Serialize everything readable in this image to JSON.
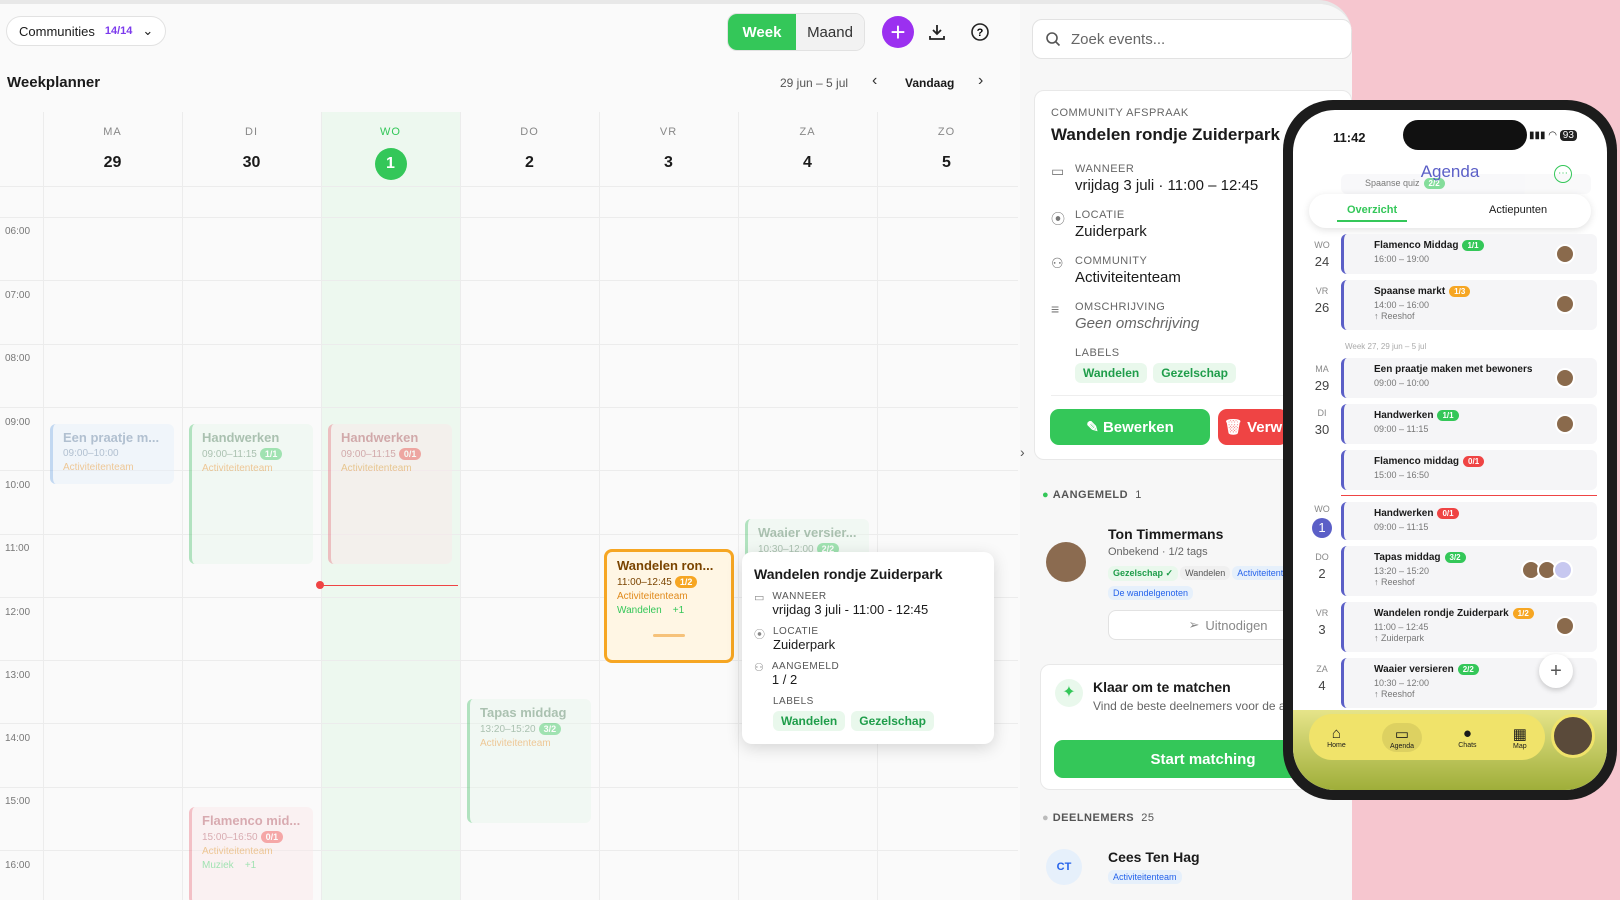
{
  "top": {
    "communities_label": "Communities",
    "communities_count": "14/14",
    "week": "Week",
    "month": "Maand",
    "add": "+"
  },
  "header": {
    "title": "Weekplanner",
    "range": "29 jun – 5 jul",
    "today": "Vandaag"
  },
  "days": [
    {
      "d": "MA",
      "n": "29"
    },
    {
      "d": "DI",
      "n": "30"
    },
    {
      "d": "WO",
      "n": "1"
    },
    {
      "d": "DO",
      "n": "2"
    },
    {
      "d": "VR",
      "n": "3"
    },
    {
      "d": "ZA",
      "n": "4"
    },
    {
      "d": "ZO",
      "n": "5"
    }
  ],
  "hours": [
    "06:00",
    "07:00",
    "08:00",
    "09:00",
    "10:00",
    "11:00",
    "12:00",
    "13:00",
    "14:00",
    "15:00",
    "16:00"
  ],
  "events": {
    "praatje": {
      "title": "Een praatje m...",
      "time": "09:00–10:00",
      "community": "Activiteitenteam"
    },
    "hand1": {
      "title": "Handwerken",
      "time": "09:00–11:15",
      "badge": "1/1",
      "community": "Activiteitenteam"
    },
    "hand2": {
      "title": "Handwerken",
      "time": "09:00–11:15",
      "badge": "0/1",
      "community": "Activiteitenteam"
    },
    "waaier": {
      "title": "Waaier versier...",
      "time": "10:30–12:00",
      "badge": "2/2"
    },
    "wandelen": {
      "title": "Wandelen ron...",
      "time": "11:00–12:45",
      "badge": "1/2",
      "community": "Activiteitenteam",
      "tag": "Wandelen",
      "more": "+1"
    },
    "tapas": {
      "title": "Tapas middag",
      "time": "13:20–15:20",
      "badge": "3/2",
      "community": "Activiteitenteam"
    },
    "flamenco": {
      "title": "Flamenco mid...",
      "time": "15:00–16:50",
      "badge": "0/1",
      "community": "Activiteitenteam",
      "tag": "Muziek",
      "more": "+1"
    }
  },
  "popover": {
    "title": "Wandelen rondje Zuiderpark",
    "when_label": "WANNEER",
    "when": "vrijdag 3 juli - 11:00 - 12:45",
    "loc_label": "LOCATIE",
    "loc": "Zuiderpark",
    "reg_label": "AANGEMELD",
    "reg": "1 / 2",
    "labels_label": "LABELS",
    "labels": [
      "Wandelen",
      "Gezelschap"
    ]
  },
  "side": {
    "search_placeholder": "Zoek events...",
    "kind": "COMMUNITY AFSPRAAK",
    "title": "Wandelen rondje Zuiderpark",
    "when_label": "WANNEER",
    "when": "vrijdag 3 juli · 11:00 – 12:45",
    "loc_label": "LOCATIE",
    "loc": "Zuiderpark",
    "comm_label": "COMMUNITY",
    "comm": "Activiteitenteam",
    "desc_label": "OMSCHRIJVING",
    "desc": "Geen omschrijving",
    "labels_label": "LABELS",
    "labels": [
      "Wandelen",
      "Gezelschap"
    ],
    "edit": "Bewerken",
    "delete": "Verw",
    "registered_label": "AANGEMELD",
    "registered_count": "1",
    "person": "Ton Timmermans",
    "person_sub": "Onbekend · 1/2 tags",
    "person_tags": [
      "Gezelschap ✓",
      "Wandelen",
      "Activiteitent",
      "De wandelgenoten"
    ],
    "invite": "Uitnodigen",
    "match_title": "Klaar om te matchen",
    "match_text": "Vind de beste deelnemers voor de afspraak",
    "match_btn": "Start matching",
    "participants_label": "DEELNEMERS",
    "participants_count": "25",
    "p2_initials": "CT",
    "p2_name": "Cees Ten Hag",
    "p2_tag": "Activiteitenteam"
  },
  "phone": {
    "time": "11:42",
    "battery": "93",
    "title": "Agenda",
    "tab1": "Overzicht",
    "tab2": "Actiepunten",
    "ghost1": "Spaanse quiz",
    "ghost1_badge": "2/2",
    "week_label": "Week 27, 29 jun – 5 jul",
    "items": [
      {
        "d": "WO",
        "n": "24",
        "t": "Flamenco Middag",
        "b": "1/1",
        "s": "16:00 – 19:00"
      },
      {
        "d": "VR",
        "n": "26",
        "t": "Spaanse markt",
        "b": "1/3",
        "s": "14:00 – 16:00",
        "l": "↑ Reeshof"
      },
      {
        "d": "MA",
        "n": "29",
        "t": "Een praatje maken met bewoners",
        "s": "09:00 – 10:00"
      },
      {
        "d": "DI",
        "n": "30",
        "t": "Handwerken",
        "b": "1/1",
        "s": "09:00 – 11:15"
      },
      {
        "t": "Flamenco middag",
        "b": "0/1",
        "s": "15:00 – 16:50"
      },
      {
        "d": "WO",
        "n": "1",
        "t": "Handwerken",
        "b": "0/1",
        "s": "09:00 – 11:15"
      },
      {
        "d": "DO",
        "n": "2",
        "t": "Tapas middag",
        "b": "3/2",
        "s": "13:20 – 15:20",
        "l": "↑ Reeshof"
      },
      {
        "d": "VR",
        "n": "3",
        "t": "Wandelen rondje Zuiderpark",
        "b": "1/2",
        "s": "11:00 – 12:45",
        "l": "↑ Zuiderpark"
      },
      {
        "d": "ZA",
        "n": "4",
        "t": "Waaier versieren",
        "b": "2/2",
        "s": "10:30 – 12:00",
        "l": "↑ Reeshof"
      }
    ],
    "nav": [
      "Home",
      "Agenda",
      "Chats",
      "Map"
    ]
  }
}
